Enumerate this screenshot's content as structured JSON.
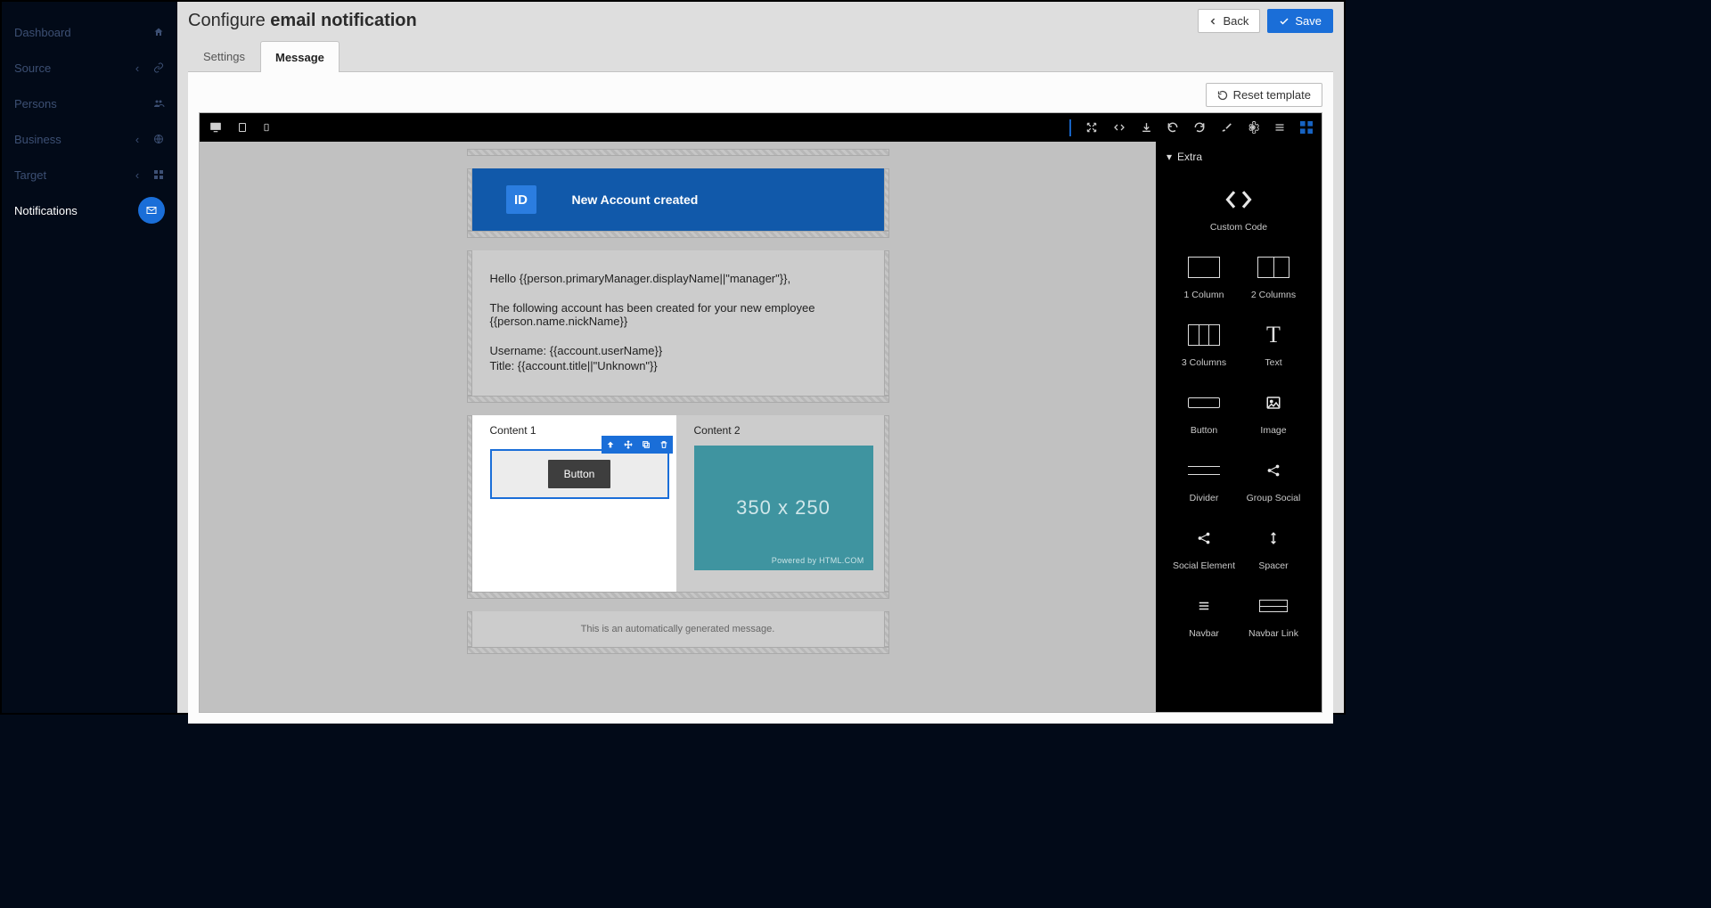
{
  "sidebar": {
    "items": [
      {
        "label": "Dashboard",
        "name": "sidebar-item-dashboard"
      },
      {
        "label": "Source",
        "name": "sidebar-item-source"
      },
      {
        "label": "Persons",
        "name": "sidebar-item-persons"
      },
      {
        "label": "Business",
        "name": "sidebar-item-business"
      },
      {
        "label": "Target",
        "name": "sidebar-item-target"
      },
      {
        "label": "Notifications",
        "name": "sidebar-item-notifications"
      }
    ]
  },
  "header": {
    "title_prefix": "Configure ",
    "title_bold": "email notification",
    "back": "Back",
    "save": "Save"
  },
  "tabs": {
    "settings": "Settings",
    "message": "Message"
  },
  "reset_template": "Reset template",
  "email": {
    "logo_text": "ID",
    "heading": "New Account created",
    "body_greeting": "Hello {{person.primaryManager.displayName||\"manager\"}},",
    "body_line1": "The following account has been created for your new employee {{person.name.nickName}}",
    "body_line2": "Username: {{account.userName}}",
    "body_line3": "Title: {{account.title||\"Unknown\"}}",
    "content1_label": "Content 1",
    "content2_label": "Content 2",
    "button_label": "Button",
    "placeholder_size": "350 x 250",
    "placeholder_powered": "Powered by HTML.COM",
    "footer": "This is an automatically generated message."
  },
  "components": {
    "section": "Extra",
    "items": [
      {
        "label": "Custom Code",
        "name": "comp-custom-code"
      },
      {
        "label": "1 Column",
        "name": "comp-1-column"
      },
      {
        "label": "2 Columns",
        "name": "comp-2-columns"
      },
      {
        "label": "3 Columns",
        "name": "comp-3-columns"
      },
      {
        "label": "Text",
        "name": "comp-text"
      },
      {
        "label": "Button",
        "name": "comp-button"
      },
      {
        "label": "Image",
        "name": "comp-image"
      },
      {
        "label": "Divider",
        "name": "comp-divider"
      },
      {
        "label": "Group Social",
        "name": "comp-group-social"
      },
      {
        "label": "Social Element",
        "name": "comp-social-element"
      },
      {
        "label": "Spacer",
        "name": "comp-spacer"
      },
      {
        "label": "Navbar",
        "name": "comp-navbar"
      },
      {
        "label": "Navbar Link",
        "name": "comp-navbar-link"
      }
    ]
  }
}
